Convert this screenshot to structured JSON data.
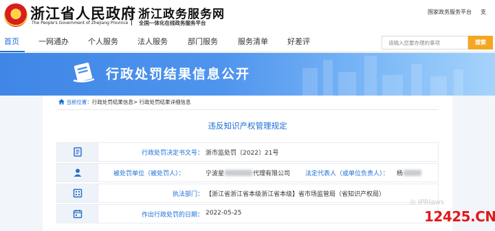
{
  "header": {
    "gov_title": "浙江省人民政府",
    "gov_subtitle": "The People's Government of Zhejiang Province",
    "service_title": "浙江政务服务网",
    "service_subtitle": "全国一体化在线政务服务平台",
    "links": [
      "国家政务服务平台",
      "支"
    ]
  },
  "nav": {
    "items": [
      "首页",
      "一网通办",
      "个人服务",
      "法人服务",
      "部门服务",
      "服务清单",
      "好差评"
    ],
    "active_index": 0,
    "search_placeholder": "请输入您要办理的事项",
    "search_button": "搜索"
  },
  "banner": {
    "title": "行政处罚结果信息公开"
  },
  "breadcrumb": {
    "home": "当前位置：",
    "path": "行政处罚结果信息> 行政处罚结果详细信息"
  },
  "document": {
    "title": "违反知识产权管理规定",
    "rows": [
      {
        "icon": "document-icon",
        "label": "行政处罚决定书文号：",
        "value": "浙市监处罚〔2022〕21号"
      },
      {
        "icon": "person-icon",
        "label": "被处罚单位（被处罚人）：",
        "value_prefix": "宁波星",
        "value_suffix": "代理有限公司",
        "label2": "法定代表人（或单位负责人）：",
        "value2": "杨"
      },
      {
        "icon": "building-icon",
        "label": "执法部门：",
        "value": "【浙江省浙江省本级浙江省本级】省市场监管局（省知识产权局）"
      },
      {
        "icon": "calendar-icon",
        "label": "作出行政处罚的日期：",
        "value": "2022-05-25"
      }
    ]
  },
  "watermarks": {
    "wechat": "IPRlaws",
    "site": "12425.CN"
  },
  "colors": {
    "accent": "#1a6fd6",
    "search_button": "#f5a623",
    "banner": "#4f95ee",
    "watermark": "#e01a1a"
  }
}
